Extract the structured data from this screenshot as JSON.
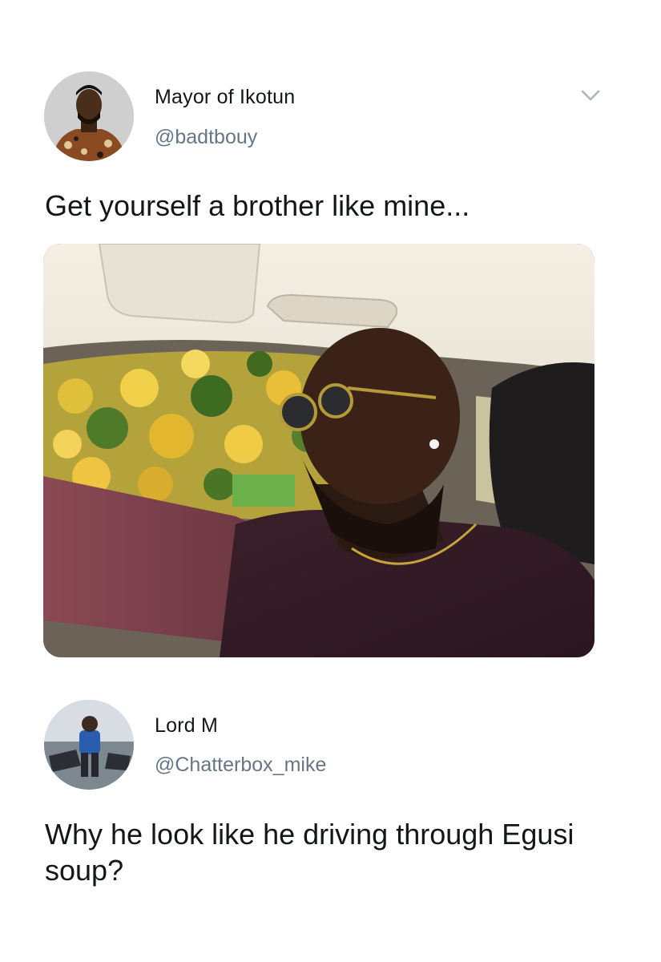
{
  "tweet": {
    "display_name": "Mayor of Ikotun",
    "handle": "@badtbouy",
    "text": "Get yourself a brother like mine...",
    "menu_icon": "chevron-down-icon",
    "media_alt": "photo of man driving car"
  },
  "reply": {
    "display_name": "Lord M",
    "handle": "@Chatterbox_mike",
    "text": "Why he look like he driving through Egusi soup?"
  },
  "colors": {
    "text": "#14171a",
    "secondary": "#657786",
    "chevron": "#aab8c2"
  }
}
